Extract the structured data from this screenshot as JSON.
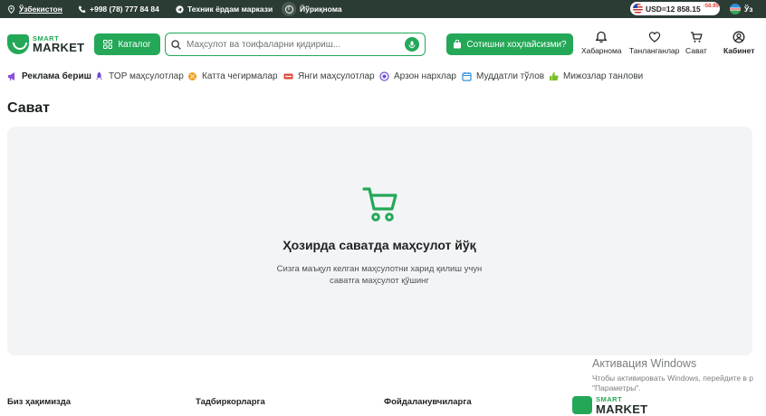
{
  "topbar": {
    "region": "Ўзбекистон",
    "phone": "+998 (78) 777 84 84",
    "support": "Техник ёрдам маркази",
    "guide": "Йўриқнома",
    "currency": "USD=12 858.15",
    "currency_diff": "-58.95",
    "language": "Ўз"
  },
  "header": {
    "logo_top": "SMART",
    "logo_bottom": "MARKET",
    "catalog_label": "Каталог",
    "search_placeholder": "Маҳсулот ва тоифаларни қидириш...",
    "sell_label": "Сотишни хоҳлайсизми?",
    "notifications": "Хабарнома",
    "favorites": "Танланганлар",
    "cart": "Сават",
    "cabinet": "Кабинет"
  },
  "nav": [
    {
      "label": "Реклама бериш",
      "icon": "megaphone-icon"
    },
    {
      "label": "TOP маҳсулотлар",
      "icon": "rocket-icon"
    },
    {
      "label": "Катта чегирмалар",
      "icon": "discount-icon"
    },
    {
      "label": "Янги маҳсулотлар",
      "icon": "new-badge-icon"
    },
    {
      "label": "Арзон нархлар",
      "icon": "coin-icon"
    },
    {
      "label": "Муддатли тўлов",
      "icon": "calendar-icon"
    },
    {
      "label": "Мижозлар танлови",
      "icon": "thumb-up-icon"
    }
  ],
  "page": {
    "title": "Сават",
    "empty_title": "Ҳозирда саватда маҳсулот йўқ",
    "empty_desc_line1": "Сизга маъқул келган маҳсулотни харид қилиш учун",
    "empty_desc_line2": "саватга маҳсулот қўшинг"
  },
  "footer": {
    "col1": "Биз ҳақимизда",
    "col2": "Тадбиркорларга",
    "col3": "Фойдаланувчиларга",
    "logo_top": "SMART",
    "logo_bottom": "MARKET"
  },
  "windows_activation": {
    "title": "Активация Windows",
    "line1": "Чтобы активировать Windows, перейдите в р",
    "line2": "\"Параметры\"."
  },
  "colors": {
    "brand_green": "#24a858",
    "topbar_bg": "#2b3c35",
    "card_bg": "#f3f4f6",
    "diff_red": "#e0463a"
  }
}
